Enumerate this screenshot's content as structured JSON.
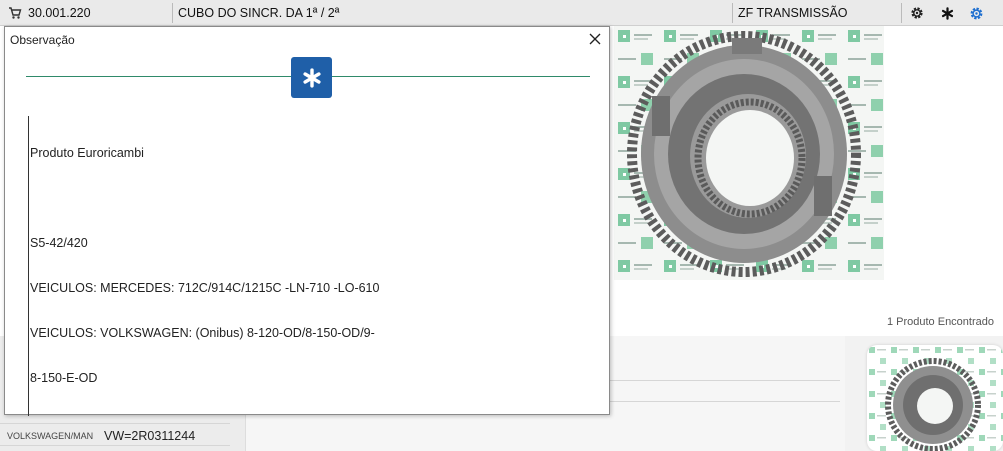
{
  "topbar": {
    "code": "30.001.220",
    "description": "CUBO DO SINCR. DA 1ª / 2ª",
    "brand": "ZF TRANSMISSÃO"
  },
  "icons": {
    "cart": "cart-icon",
    "gear": "gear-icon",
    "asterisk": "asterisk-icon",
    "settings": "settings-icon",
    "close": "close-icon"
  },
  "colors": {
    "badge": "#1f5fa8",
    "divider": "#2f8a6a",
    "settings_icon": "#1e6fd0"
  },
  "result": {
    "found_text": "1 Produto Encontrado"
  },
  "details": {
    "row_label": "VOLKSWAGEN/MAN",
    "row_value": "VW=2R0311244"
  },
  "modal": {
    "title": "Observação",
    "lines": [
      "Produto Euroricambi",
      "",
      "S5-42/420",
      "VEICULOS: MERCEDES: 712C/914C/1215C -LN-710 -LO-610",
      "VEICULOS: VOLKSWAGEN: (Onibus) 8-120-OD/8-150-OD/9-",
      "8-150-E-OD"
    ]
  }
}
